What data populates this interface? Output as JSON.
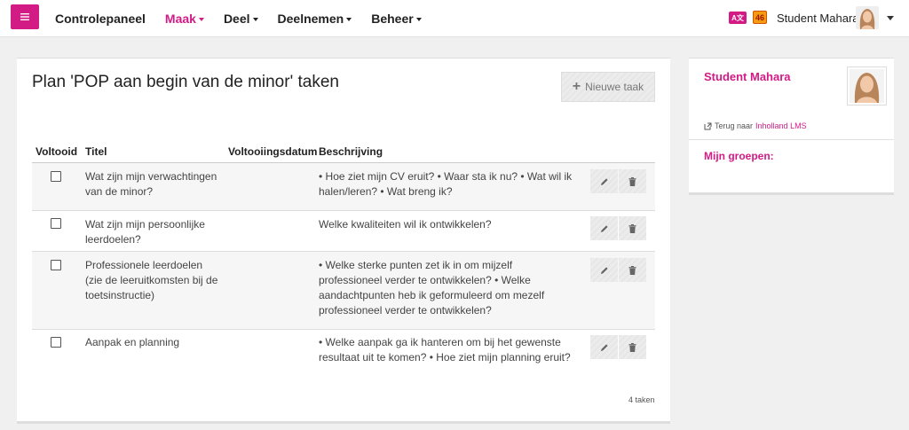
{
  "nav": {
    "items": [
      {
        "label": "Controlepaneel",
        "dropdown": false,
        "active": false
      },
      {
        "label": "Maak",
        "dropdown": true,
        "active": true
      },
      {
        "label": "Deel",
        "dropdown": true,
        "active": false
      },
      {
        "label": "Deelnemen",
        "dropdown": true,
        "active": false
      },
      {
        "label": "Beheer",
        "dropdown": true,
        "active": false
      }
    ],
    "lang_icon_text": "A文",
    "badge_count": "46",
    "user_name": "Student Mahara"
  },
  "page": {
    "title": "Plan 'POP aan begin van de minor' taken",
    "new_task_label": "Nieuwe taak",
    "columns": {
      "completed": "Voltooid",
      "title": "Titel",
      "completion_date": "Voltooiingsdatum",
      "description": "Beschrijving"
    },
    "tasks": [
      {
        "title": "Wat zijn mijn verwachtingen van de minor?",
        "completion_date": "",
        "description": "• Hoe ziet mijn CV eruit? • Waar sta ik nu? • Wat wil ik halen/leren? • Wat breng ik?",
        "completed": false
      },
      {
        "title": "Wat zijn mijn persoonlijke leerdoelen?",
        "completion_date": "",
        "description": "Welke kwaliteiten wil ik ontwikkelen?",
        "completed": false
      },
      {
        "title": "Professionele leerdoelen (zie de leeruitkomsten bij de toetsinstructie)",
        "completion_date": "",
        "description": "• Welke sterke punten zet ik in om mijzelf professioneel verder te ontwikkelen? • Welke aandachtpunten heb ik geformuleerd om mezelf professioneel verder te ontwikkelen?",
        "completed": false
      },
      {
        "title": "Aanpak en planning",
        "completion_date": "",
        "description": "• Welke aanpak ga ik hanteren om bij het gewenste resultaat uit te komen? • Hoe ziet mijn planning eruit?",
        "completed": false
      }
    ],
    "task_count": "4 taken"
  },
  "sidebar": {
    "name": "Student Mahara",
    "back_prefix": "Terug naar",
    "back_link": "Inholland LMS",
    "groups_heading": "Mijn groepen:"
  },
  "colors": {
    "accent": "#d31b86"
  },
  "icons": {
    "menu": "hamburger-icon",
    "language": "language-icon",
    "notifications": "notification-badge-icon",
    "add": "plus-icon",
    "edit": "pencil-icon",
    "delete": "trash-icon",
    "external": "external-link-icon"
  }
}
